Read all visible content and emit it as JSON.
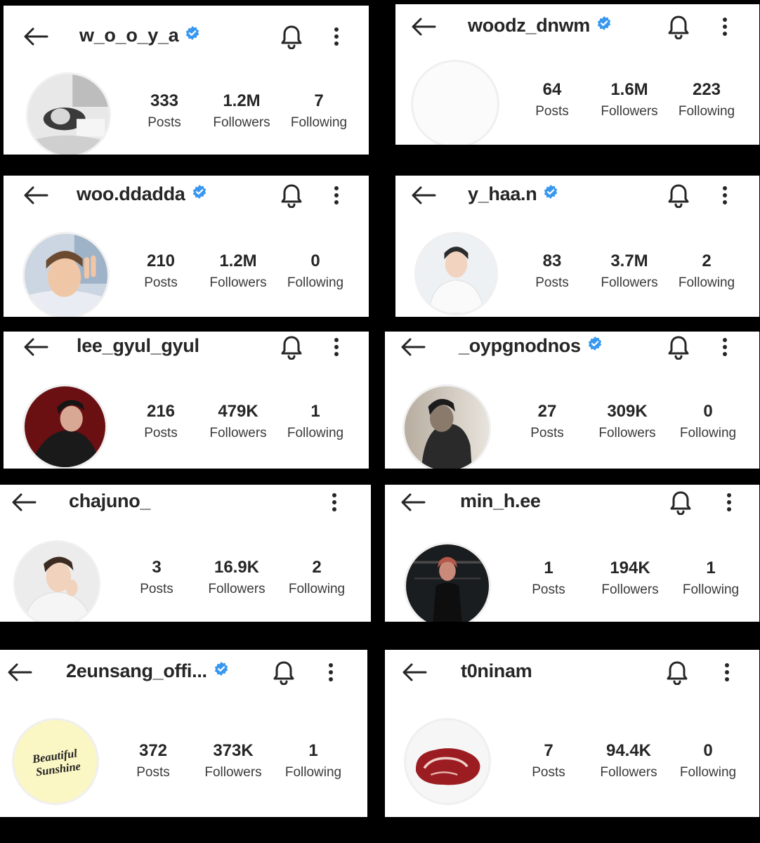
{
  "profiles": [
    {
      "username": "w_o_o_y_a",
      "verified": true,
      "bell": true,
      "avatar": "grayscale-lying-photo",
      "posts": "333",
      "followers": "1.2M",
      "following": "7",
      "posts_label": "Posts",
      "followers_label": "Followers",
      "following_label": "Following"
    },
    {
      "username": "woodz_dnwm",
      "verified": true,
      "bell": true,
      "avatar": "blank-white-photo",
      "posts": "64",
      "followers": "1.6M",
      "following": "223",
      "posts_label": "Posts",
      "followers_label": "Followers",
      "following_label": "Following"
    },
    {
      "username": "woo.ddadda",
      "verified": true,
      "bell": true,
      "avatar": "peace-sign-selfie",
      "posts": "210",
      "followers": "1.2M",
      "following": "0",
      "posts_label": "Posts",
      "followers_label": "Followers",
      "following_label": "Following"
    },
    {
      "username": "y_haa.n",
      "verified": true,
      "bell": true,
      "avatar": "white-sweater-portrait",
      "posts": "83",
      "followers": "3.7M",
      "following": "2",
      "posts_label": "Posts",
      "followers_label": "Followers",
      "following_label": "Following"
    },
    {
      "username": "lee_gyul_gyul",
      "verified": false,
      "bell": true,
      "avatar": "dark-red-portrait",
      "posts": "216",
      "followers": "479K",
      "following": "1",
      "posts_label": "Posts",
      "followers_label": "Followers",
      "following_label": "Following"
    },
    {
      "username": "_oypgnodnos",
      "verified": true,
      "bell": true,
      "avatar": "shadow-profile-photo",
      "posts": "27",
      "followers": "309K",
      "following": "0",
      "posts_label": "Posts",
      "followers_label": "Followers",
      "following_label": "Following"
    },
    {
      "username": "chajuno_",
      "verified": false,
      "bell": false,
      "avatar": "hand-on-face-portrait",
      "posts": "3",
      "followers": "16.9K",
      "following": "2",
      "posts_label": "Posts",
      "followers_label": "Followers",
      "following_label": "Following"
    },
    {
      "username": "min_h.ee",
      "verified": false,
      "bell": true,
      "avatar": "dark-room-standing-photo",
      "posts": "1",
      "followers": "194K",
      "following": "1",
      "posts_label": "Posts",
      "followers_label": "Followers",
      "following_label": "Following"
    },
    {
      "username": "2eunsang_offi...",
      "verified": true,
      "bell": true,
      "avatar": "beautiful-sunshine-logo",
      "avatar_text": "Beautiful Sunshine",
      "posts": "372",
      "followers": "373K",
      "following": "1",
      "posts_label": "Posts",
      "followers_label": "Followers",
      "following_label": "Following"
    },
    {
      "username": "t0ninam",
      "verified": false,
      "bell": true,
      "avatar": "raw-steak-photo",
      "posts": "7",
      "followers": "94.4K",
      "following": "0",
      "posts_label": "Posts",
      "followers_label": "Followers",
      "following_label": "Following"
    }
  ],
  "icons": {
    "back": "arrow-left-icon",
    "bell": "bell-icon",
    "more": "more-vertical-icon",
    "verified": "verified-badge-icon"
  },
  "colors": {
    "verified_blue": "#3897f0",
    "background": "#000000",
    "card": "#ffffff"
  }
}
